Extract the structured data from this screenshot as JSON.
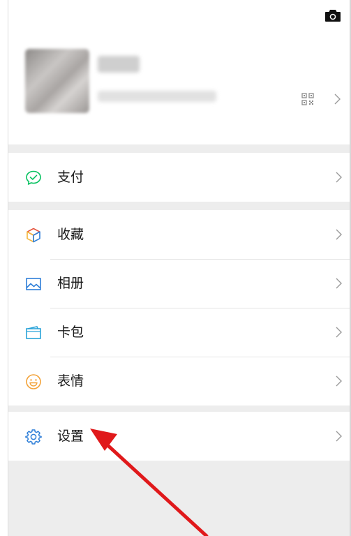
{
  "profile": {
    "nickname": "",
    "wechat_id": "",
    "icons": [
      "camera-icon",
      "qr-code-icon",
      "chevron-right-icon"
    ]
  },
  "menu": {
    "pay_label": "支付",
    "favorites_label": "收藏",
    "album_label": "相册",
    "cards_label": "卡包",
    "stickers_label": "表情",
    "settings_label": "设置"
  },
  "colors": {
    "pay": "#07c160",
    "album": "#2f7fd8",
    "cards": "#2aa3d9",
    "stickers": "#f3a238",
    "settings": "#2f7fd8",
    "annotation_arrow": "#e0191b",
    "background": "#ededed"
  }
}
